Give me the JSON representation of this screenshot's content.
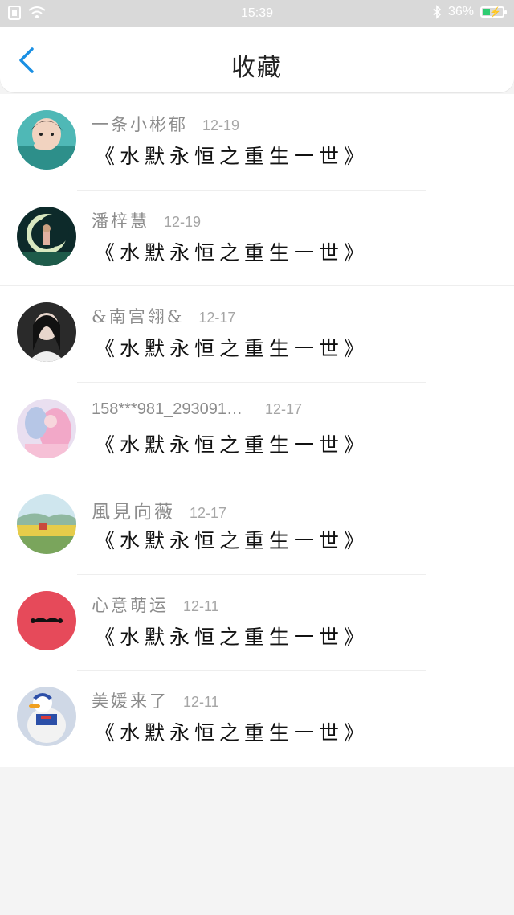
{
  "status_bar": {
    "time": "15:39",
    "battery": "36%",
    "battery_level": 0.36,
    "battery_color": "#2ecc71"
  },
  "header": {
    "title": "收藏",
    "back_icon": "chevron-left-icon",
    "accent": "#1a8fe3"
  },
  "items": [
    {
      "name": "一条小彬郁",
      "date": "12-19",
      "content": "《水默永恒之重生一世》"
    },
    {
      "name": "潘梓慧",
      "date": "12-19",
      "content": "《水默永恒之重生一世》"
    },
    {
      "name": "&南宫翎&",
      "date": "12-17",
      "content": "《水默永恒之重生一世》"
    },
    {
      "name": "158***981_293091…",
      "date": "12-17",
      "content": "《水默永恒之重生一世》"
    },
    {
      "name": "風見向薇",
      "date": "12-17",
      "content": "《水默永恒之重生一世》"
    },
    {
      "name": "心意萌运",
      "date": "12-11",
      "content": "《水默永恒之重生一世》"
    },
    {
      "name": "美媛来了",
      "date": "12-11",
      "content": "《水默永恒之重生一世》"
    }
  ]
}
